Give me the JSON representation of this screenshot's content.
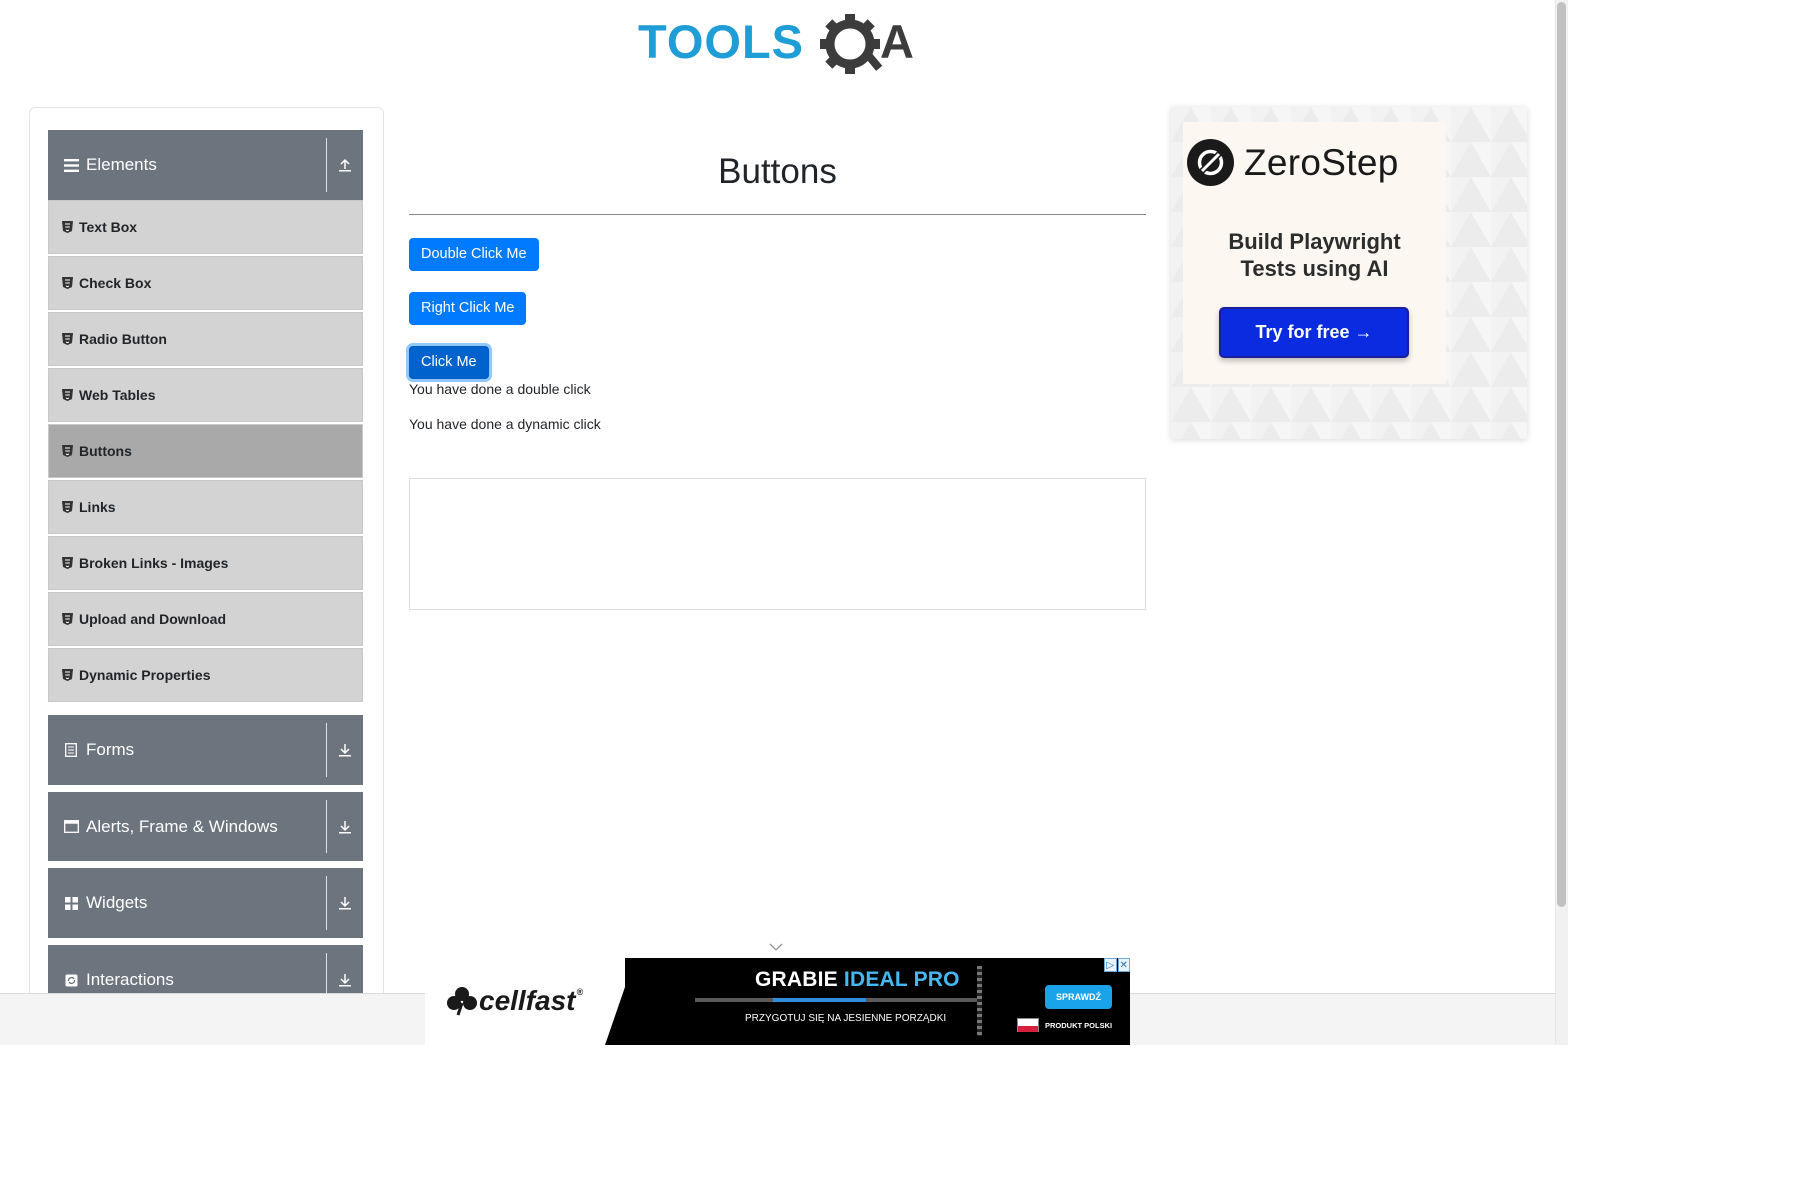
{
  "site": {
    "logo_text_tools": "TOOLS",
    "logo_text_qa": "QA"
  },
  "colors": {
    "primary": "#007bff",
    "sidebar_header": "#6c757d",
    "menu_item": "#d3d3d3",
    "menu_item_active": "#a9a9a9",
    "zerostep_button": "#0a2be0"
  },
  "sidebar": {
    "elements_group": {
      "label": "Elements",
      "icon": "hamburger-icon",
      "expanded": true
    },
    "items": [
      {
        "label": "Text Box",
        "active": false
      },
      {
        "label": "Check Box",
        "active": false
      },
      {
        "label": "Radio Button",
        "active": false
      },
      {
        "label": "Web Tables",
        "active": false
      },
      {
        "label": "Buttons",
        "active": true
      },
      {
        "label": "Links",
        "active": false
      },
      {
        "label": "Broken Links - Images",
        "active": false
      },
      {
        "label": "Upload and Download",
        "active": false
      },
      {
        "label": "Dynamic Properties",
        "active": false
      }
    ],
    "groups": [
      {
        "label": "Forms",
        "icon": "document-icon"
      },
      {
        "label": "Alerts, Frame & Windows",
        "icon": "window-icon"
      },
      {
        "label": "Widgets",
        "icon": "grid-icon"
      },
      {
        "label": "Interactions",
        "icon": "interactions-icon"
      }
    ]
  },
  "main": {
    "title": "Buttons",
    "buttons": {
      "double_click": "Double Click Me",
      "right_click": "Right Click Me",
      "click": "Click Me"
    },
    "messages": {
      "double_click": "You have done a double click",
      "dynamic_click": "You have done a dynamic click"
    }
  },
  "right_ad": {
    "brand": "ZeroStep",
    "tagline_line1": "Build Playwright",
    "tagline_line2": "Tests using AI",
    "cta": "Try for free →"
  },
  "bottom_banner": {
    "brand": "cellfast",
    "brand_reg": "®",
    "headline_a": "GRABIE ",
    "headline_b": "IDEAL PRO",
    "subline": "PRZYGOTUJ SIĘ NA JESIENNE PORZĄDKI",
    "cta": "SPRAWDŹ",
    "made_in": "PRODUKT POLSKI",
    "adchoices": "▷",
    "close": "✕"
  }
}
